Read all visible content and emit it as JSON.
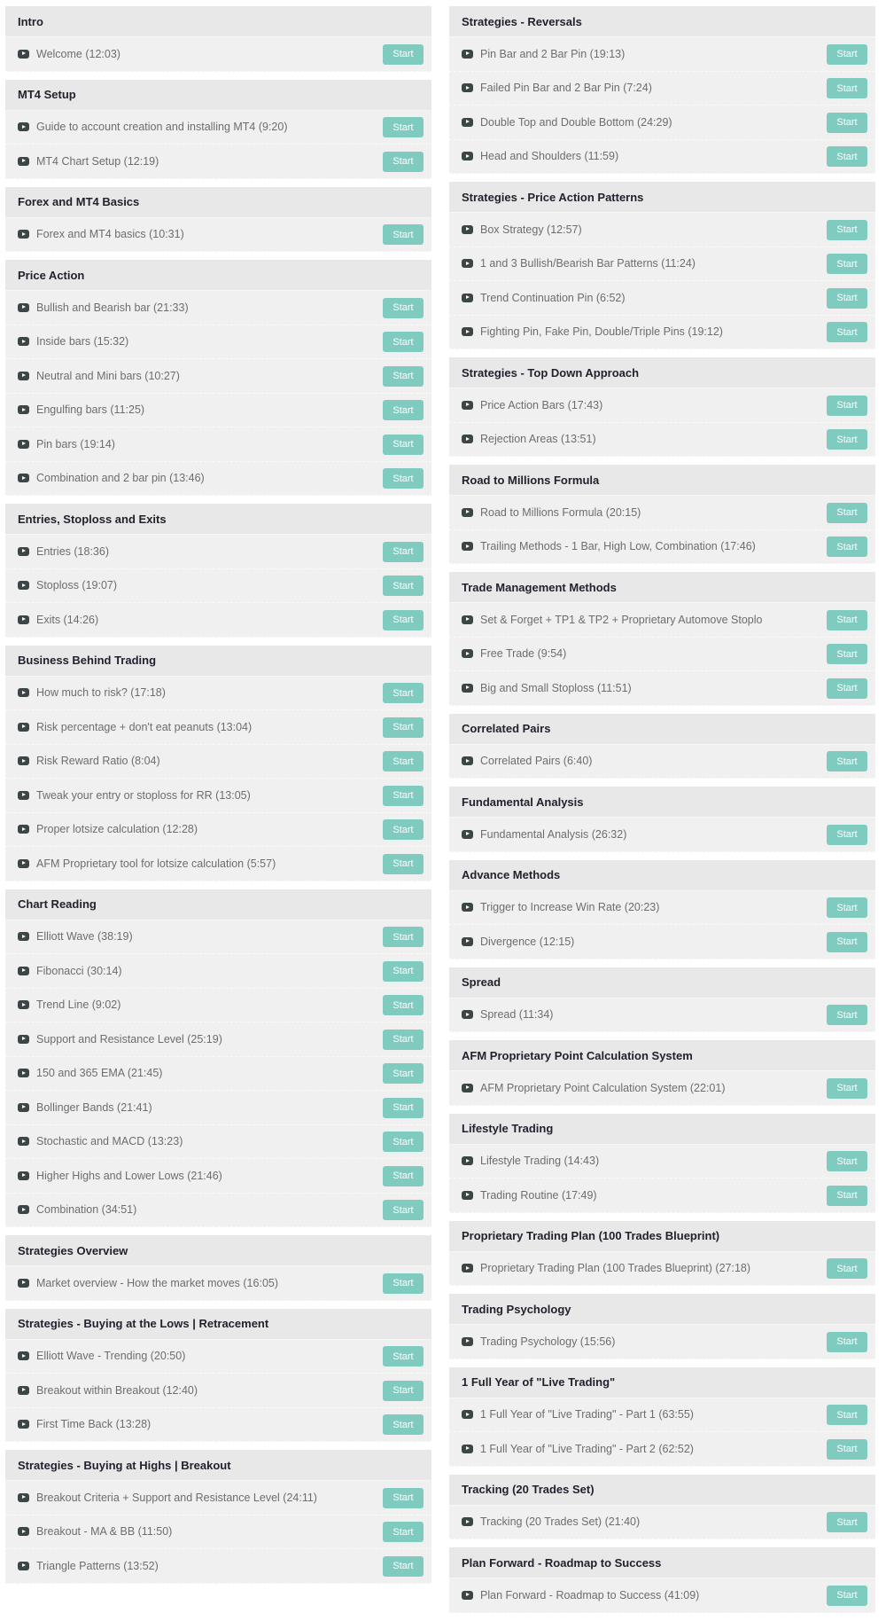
{
  "button_label": "Start",
  "colors": {
    "accent": "#80cbc0",
    "header_bg": "#e8e8e8",
    "row_bg": "#f0f0f0"
  },
  "item_icon": "play-video-icon",
  "left": [
    {
      "title": "Intro",
      "items": [
        "Welcome (12:03)"
      ]
    },
    {
      "title": "MT4 Setup",
      "items": [
        "Guide to account creation and installing MT4 (9:20)",
        "MT4 Chart Setup (12:19)"
      ]
    },
    {
      "title": "Forex and MT4 Basics",
      "items": [
        "Forex and MT4 basics (10:31)"
      ]
    },
    {
      "title": "Price Action",
      "items": [
        "Bullish and Bearish bar (21:33)",
        "Inside bars (15:32)",
        "Neutral and Mini bars (10:27)",
        "Engulfing bars (11:25)",
        "Pin bars (19:14)",
        "Combination and 2 bar pin (13:46)"
      ]
    },
    {
      "title": "Entries, Stoploss and Exits",
      "items": [
        "Entries (18:36)",
        "Stoploss (19:07)",
        "Exits (14:26)"
      ]
    },
    {
      "title": "Business Behind Trading",
      "items": [
        "How much to risk? (17:18)",
        "Risk percentage + don't eat peanuts (13:04)",
        "Risk Reward Ratio (8:04)",
        "Tweak your entry or stoploss for RR (13:05)",
        "Proper lotsize calculation (12:28)",
        "AFM Proprietary tool for lotsize calculation (5:57)"
      ]
    },
    {
      "title": "Chart Reading",
      "items": [
        "Elliott Wave (38:19)",
        "Fibonacci (30:14)",
        "Trend Line (9:02)",
        "Support and Resistance Level (25:19)",
        "150 and 365 EMA (21:45)",
        "Bollinger Bands (21:41)",
        "Stochastic and MACD (13:23)",
        "Higher Highs and Lower Lows (21:46)",
        "Combination (34:51)"
      ]
    },
    {
      "title": "Strategies Overview",
      "items": [
        "Market overview - How the market moves (16:05)"
      ]
    },
    {
      "title": "Strategies - Buying at the Lows | Retracement",
      "items": [
        "Elliott Wave - Trending (20:50)",
        "Breakout within Breakout (12:40)",
        "First Time Back (13:28)"
      ]
    },
    {
      "title": "Strategies - Buying at Highs | Breakout",
      "items": [
        "Breakout Criteria + Support and Resistance Level (24:11)",
        "Breakout - MA & BB (11:50)",
        "Triangle Patterns (13:52)"
      ]
    }
  ],
  "right": [
    {
      "title": "Strategies - Reversals",
      "items": [
        "Pin Bar and 2 Bar Pin (19:13)",
        "Failed Pin Bar and 2 Bar Pin (7:24)",
        "Double Top and Double Bottom (24:29)",
        "Head and Shoulders (11:59)"
      ]
    },
    {
      "title": "Strategies - Price Action Patterns",
      "items": [
        "Box Strategy (12:57)",
        "1 and 3 Bullish/Bearish Bar Patterns (11:24)",
        "Trend Continuation Pin (6:52)",
        "Fighting Pin, Fake Pin, Double/Triple Pins (19:12)"
      ]
    },
    {
      "title": "Strategies - Top Down Approach",
      "items": [
        "Price Action Bars (17:43)",
        "Rejection Areas (13:51)"
      ]
    },
    {
      "title": "Road to Millions Formula",
      "items": [
        "Road to Millions Formula (20:15)",
        "Trailing Methods - 1 Bar, High Low, Combination (17:46)"
      ]
    },
    {
      "title": "Trade Management Methods",
      "items": [
        "Set & Forget + TP1 & TP2 + Proprietary Automove Stoplo",
        "Free Trade (9:54)",
        "Big and Small Stoploss (11:51)"
      ]
    },
    {
      "title": "Correlated Pairs",
      "items": [
        "Correlated Pairs (6:40)"
      ]
    },
    {
      "title": "Fundamental Analysis",
      "items": [
        "Fundamental Analysis (26:32)"
      ]
    },
    {
      "title": "Advance Methods",
      "items": [
        "Trigger to Increase Win Rate (20:23)",
        "Divergence (12:15)"
      ]
    },
    {
      "title": "Spread",
      "items": [
        "Spread (11:34)"
      ]
    },
    {
      "title": "AFM Proprietary Point Calculation System",
      "items": [
        "AFM Proprietary Point Calculation System (22:01)"
      ]
    },
    {
      "title": "Lifestyle Trading",
      "items": [
        "Lifestyle Trading (14:43)",
        "Trading Routine (17:49)"
      ]
    },
    {
      "title": "Proprietary Trading Plan (100 Trades Blueprint)",
      "items": [
        "Proprietary Trading Plan (100 Trades Blueprint) (27:18)"
      ]
    },
    {
      "title": "Trading Psychology",
      "items": [
        "Trading Psychology (15:56)"
      ]
    },
    {
      "title": "1 Full Year of \"Live Trading\"",
      "items": [
        "1 Full Year of \"Live Trading\" - Part 1 (63:55)",
        "1 Full Year of \"Live Trading\" - Part 2 (62:52)"
      ]
    },
    {
      "title": "Tracking (20 Trades Set)",
      "items": [
        "Tracking (20 Trades Set) (21:40)"
      ]
    },
    {
      "title": "Plan Forward - Roadmap to Success",
      "items": [
        "Plan Forward - Roadmap to Success (41:09)"
      ]
    }
  ]
}
